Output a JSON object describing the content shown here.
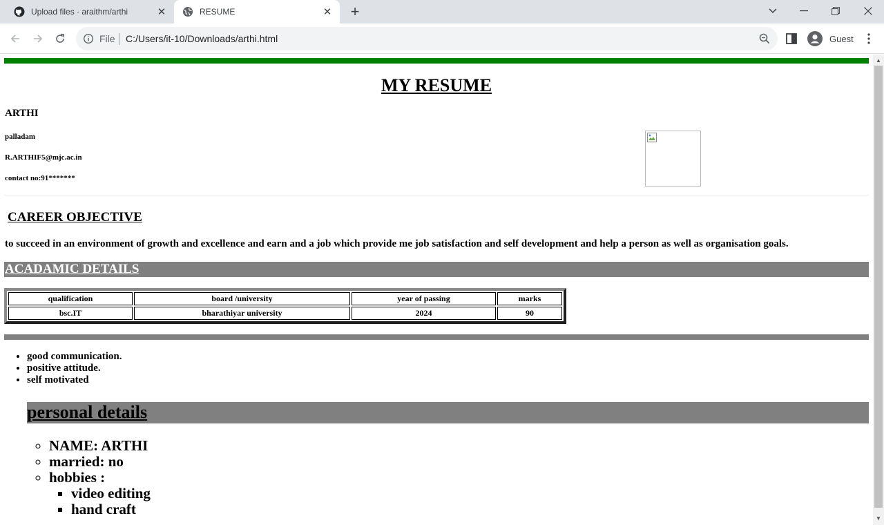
{
  "browser": {
    "tabs": [
      {
        "title": "Upload files · araithm/arthi",
        "active": false,
        "icon": "github-icon"
      },
      {
        "title": "RESUME",
        "active": true,
        "icon": "globe-icon"
      }
    ],
    "omnibox": {
      "scheme_label": "File",
      "url": "C:/Users/it-10/Downloads/arthi.html"
    },
    "profile_label": "Guest"
  },
  "page": {
    "title": "MY RESUME",
    "name": "ARTHI",
    "address": "palladam",
    "email": "R.ARTHIF5@mjc.ac.in",
    "contact": "contact no:91*******",
    "career_heading": "CAREER OBJECTIVE",
    "objective": "to succeed in an environment of growth and excellence and earn and a job which provide me job satisfaction and self development and help a person as well as organisation goals.",
    "academic_heading": "ACADAMIC DETAILS",
    "academic_table": {
      "headers": [
        "qualification",
        "board /university",
        "year of passing",
        "marks"
      ],
      "rows": [
        [
          "bsc.IT",
          "bharathiyar university",
          "2024",
          "90"
        ]
      ]
    },
    "skills": [
      "good communication.",
      "positive attitude.",
      "self motivated"
    ],
    "personal_heading": "personal details",
    "personal": {
      "name_item": "NAME: ARTHI",
      "married_item": "married: no",
      "hobbies_item": "hobbies :",
      "hobbies": [
        "video editing",
        "hand craft"
      ]
    }
  },
  "colors": {
    "top_bar": "#008000",
    "section_band": "#808080"
  }
}
